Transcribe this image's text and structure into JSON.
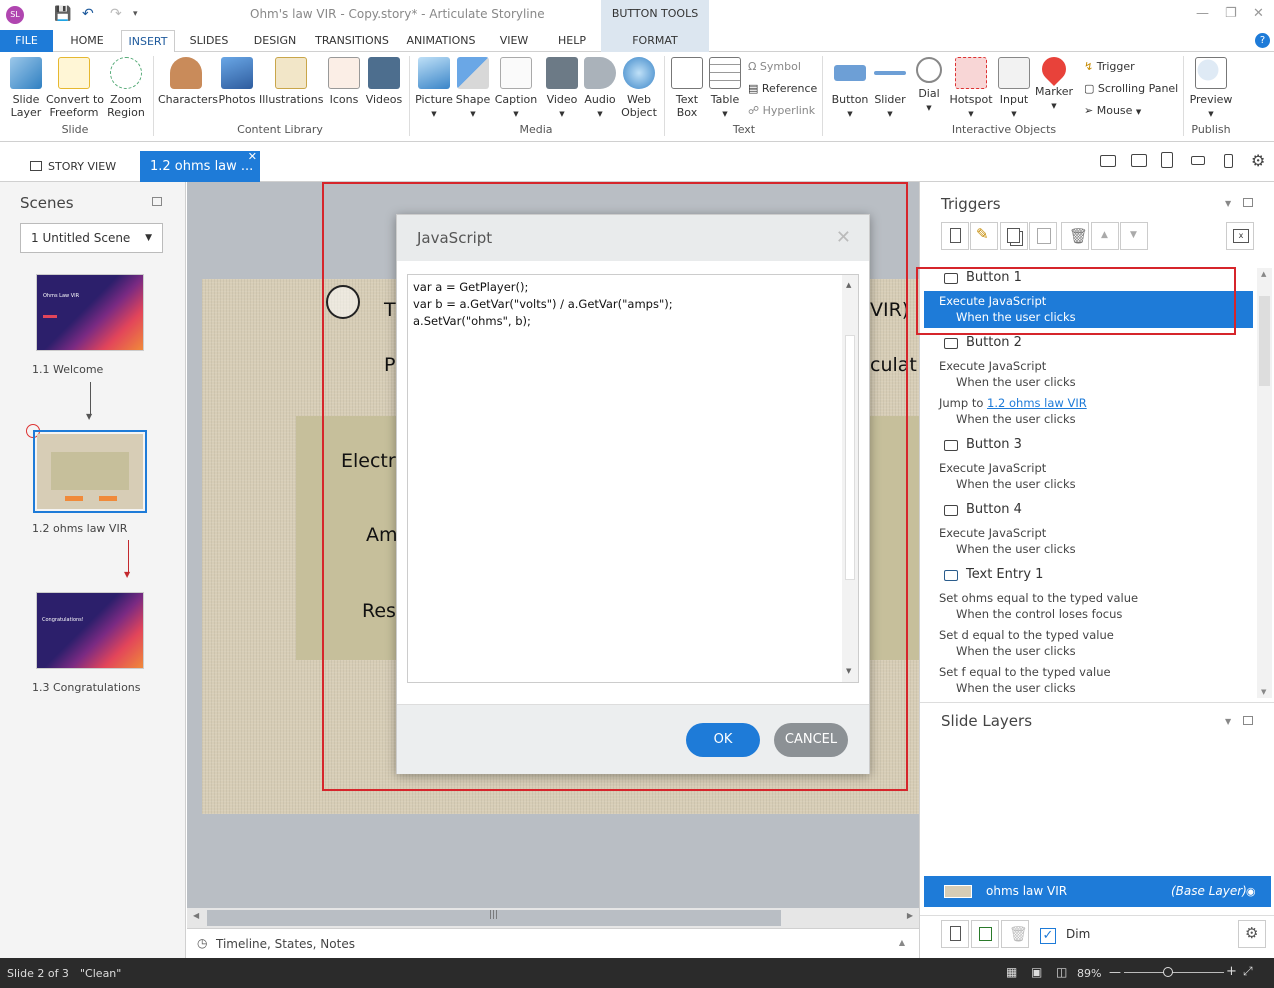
{
  "window": {
    "title": "Ohm's law VIR - Copy.story* - Articulate Storyline",
    "app_badge": "SL",
    "context_tab": "BUTTON TOOLS"
  },
  "menu": {
    "file": "FILE",
    "tabs": [
      "HOME",
      "INSERT",
      "SLIDES",
      "DESIGN",
      "TRANSITIONS",
      "ANIMATIONS",
      "VIEW",
      "HELP"
    ],
    "format": "FORMAT"
  },
  "ribbon": {
    "slide_group": {
      "items": [
        "Slide\nLayer",
        "Convert to\nFreeform",
        "Zoom\nRegion"
      ],
      "label": "Slide"
    },
    "content_group": {
      "items": [
        "Characters",
        "Photos",
        "Illustrations",
        "Icons",
        "Videos"
      ],
      "label": "Content Library"
    },
    "media_group": {
      "items": [
        "Picture",
        "Shape",
        "Caption",
        "Video",
        "Audio",
        "Web\nObject"
      ],
      "label": "Media"
    },
    "text_group": {
      "items": [
        "Text\nBox",
        "Table"
      ],
      "small": [
        "Symbol",
        "Reference",
        "Hyperlink"
      ],
      "label": "Text"
    },
    "interactive_group": {
      "items": [
        "Button",
        "Slider",
        "Dial",
        "Hotspot",
        "Input",
        "Marker"
      ],
      "small": [
        "Trigger",
        "Scrolling Panel",
        "Mouse"
      ],
      "label": "Interactive Objects"
    },
    "publish_group": {
      "items": [
        "Preview"
      ],
      "label": "Publish"
    }
  },
  "viewbar": {
    "story_view": "STORY VIEW",
    "slide_tab": "1.2 ohms law ..."
  },
  "scenes": {
    "title": "Scenes",
    "selected_scene": "1 Untitled Scene",
    "slides": [
      {
        "label": "1.1 Welcome",
        "thumb_title": "Ohms Law VIR"
      },
      {
        "label": "1.2 ohms law VIR"
      },
      {
        "label": "1.3 Congratulations",
        "thumb_title": "Congratulations!"
      }
    ]
  },
  "slide": {
    "title_start": "T",
    "title_end": "VIR)",
    "line2_start": "P",
    "line2_end": "culat",
    "labels": [
      "Electr",
      "Am",
      "Res"
    ]
  },
  "dialog": {
    "title": "JavaScript",
    "code": "var a = GetPlayer();\nvar b = a.GetVar(\"volts\") / a.GetVar(\"amps\");\na.SetVar(\"ohms\", b);",
    "ok": "OK",
    "cancel": "CANCEL"
  },
  "triggers": {
    "title": "Triggers",
    "groups": [
      {
        "object": "Button 1",
        "actions": [
          {
            "action": "Execute JavaScript",
            "when": "When the user clicks"
          }
        ]
      },
      {
        "object": "Button 2",
        "actions": [
          {
            "action": "Execute JavaScript",
            "when": "When the user clicks"
          },
          {
            "action_prefix": "Jump to ",
            "action_link": "1.2 ohms law VIR",
            "when": "When the user clicks"
          }
        ]
      },
      {
        "object": "Button 3",
        "actions": [
          {
            "action": "Execute JavaScript",
            "when": "When the user clicks"
          }
        ]
      },
      {
        "object": "Button 4",
        "actions": [
          {
            "action": "Execute JavaScript",
            "when": "When the user clicks"
          }
        ]
      },
      {
        "object": "Text Entry 1",
        "actions": [
          {
            "action": "Set ohms equal to the typed value",
            "when": "When the control loses focus"
          },
          {
            "action": "Set d equal to the typed value",
            "when": "When the user clicks"
          },
          {
            "action": "Set f equal to the typed value",
            "when": "When the user clicks"
          }
        ]
      }
    ]
  },
  "layers": {
    "title": "Slide Layers",
    "base_name": "ohms law VIR",
    "base_tag": "(Base Layer)",
    "dim": "Dim"
  },
  "timeline": {
    "label": "Timeline, States, Notes"
  },
  "status": {
    "slide": "Slide 2 of 3",
    "theme": "\"Clean\"",
    "zoom": "89%"
  },
  "colors": {
    "accent": "#1e7bd8",
    "highlight": "#d6252b",
    "ok": "#1e7bd8",
    "cancel": "#8c9195"
  }
}
